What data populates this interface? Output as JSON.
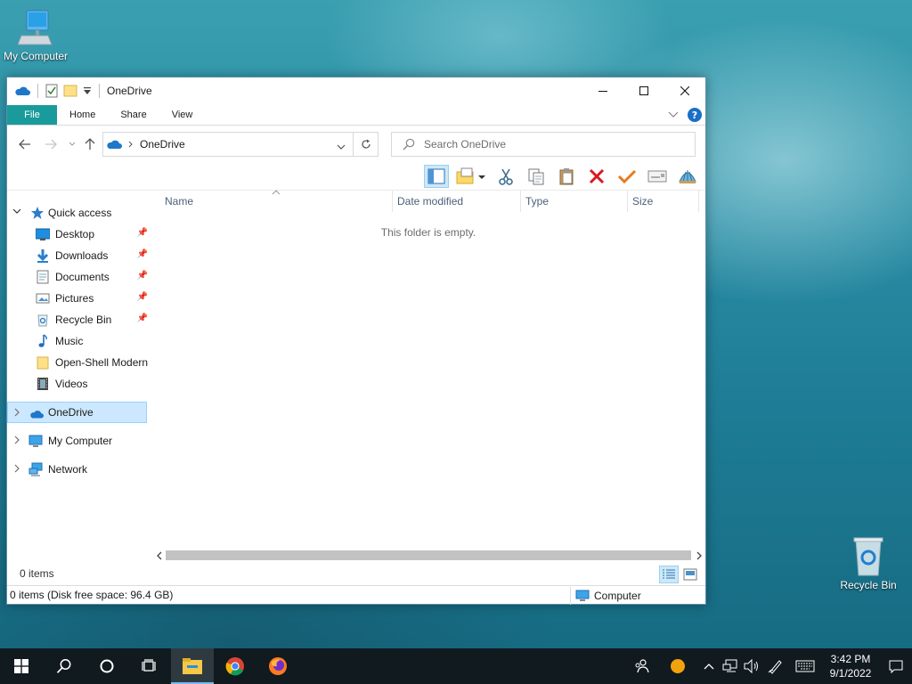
{
  "desktop": {
    "icons": [
      {
        "label": "My Computer"
      },
      {
        "label": "Recycle Bin"
      }
    ]
  },
  "window": {
    "title": "OneDrive",
    "ribbon_tabs": [
      "File",
      "Home",
      "Share",
      "View"
    ],
    "address": {
      "location": "OneDrive"
    },
    "search": {
      "placeholder": "Search OneDrive"
    },
    "columns": [
      "Name",
      "Date modified",
      "Type",
      "Size"
    ],
    "empty_message": "This folder is empty.",
    "status_items": "0 items",
    "info_left": "0 items (Disk free space: 96.4 GB)",
    "info_right": "Computer"
  },
  "sidebar": {
    "quick_access": "Quick access",
    "items": [
      {
        "label": "Desktop",
        "icon": "desktop-icon",
        "pinned": true
      },
      {
        "label": "Downloads",
        "icon": "downloads-icon",
        "pinned": true
      },
      {
        "label": "Documents",
        "icon": "documents-icon",
        "pinned": true
      },
      {
        "label": "Pictures",
        "icon": "pictures-icon",
        "pinned": true
      },
      {
        "label": "Recycle Bin",
        "icon": "recycle-bin-icon",
        "pinned": true
      },
      {
        "label": "Music",
        "icon": "music-icon",
        "pinned": false
      },
      {
        "label": "Open-Shell Modern",
        "icon": "folder-icon",
        "pinned": false
      },
      {
        "label": "Videos",
        "icon": "videos-icon",
        "pinned": false
      }
    ],
    "roots": [
      {
        "label": "OneDrive",
        "selected": true
      },
      {
        "label": "My Computer",
        "selected": false
      },
      {
        "label": "Network",
        "selected": false
      }
    ]
  },
  "taskbar": {
    "time": "3:42 PM",
    "date": "9/1/2022"
  },
  "colors": {
    "file_tab": "#1a9b9b",
    "selection": "#cce8ff",
    "accent": "#1979ca"
  }
}
